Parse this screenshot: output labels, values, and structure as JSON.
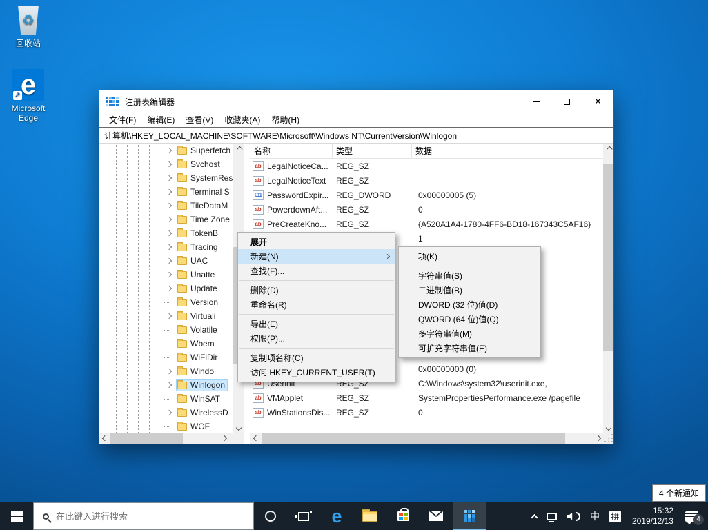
{
  "desktop": {
    "icons": [
      {
        "label": "回收站"
      },
      {
        "label": "Microsoft Edge"
      }
    ],
    "background_top": "#1995ea",
    "background_edge": "#085194"
  },
  "window": {
    "title": "注册表编辑器",
    "menubar": [
      {
        "pre": "文件(",
        "key": "F",
        "post": ")"
      },
      {
        "pre": "编辑(",
        "key": "E",
        "post": ")"
      },
      {
        "pre": "查看(",
        "key": "V",
        "post": ")"
      },
      {
        "pre": "收藏夹(",
        "key": "A",
        "post": ")"
      },
      {
        "pre": "帮助(",
        "key": "H",
        "post": ")"
      }
    ],
    "address": "计算机\\HKEY_LOCAL_MACHINE\\SOFTWARE\\Microsoft\\Windows NT\\CurrentVersion\\Winlogon",
    "tree": {
      "items": [
        {
          "label": "Superfetch",
          "has_children": true,
          "selected": false
        },
        {
          "label": "Svchost",
          "has_children": true,
          "selected": false
        },
        {
          "label": "SystemRes",
          "has_children": true,
          "selected": false
        },
        {
          "label": "Terminal S",
          "has_children": true,
          "selected": false
        },
        {
          "label": "TileDataM",
          "has_children": true,
          "selected": false
        },
        {
          "label": "Time Zone",
          "has_children": true,
          "selected": false
        },
        {
          "label": "TokenB",
          "has_children": true,
          "selected": false
        },
        {
          "label": "Tracing",
          "has_children": true,
          "selected": false
        },
        {
          "label": "UAC",
          "has_children": true,
          "selected": false
        },
        {
          "label": "Unatte",
          "has_children": true,
          "selected": false
        },
        {
          "label": "Update",
          "has_children": true,
          "selected": false
        },
        {
          "label": "Version",
          "has_children": false,
          "selected": false
        },
        {
          "label": "Virtuali",
          "has_children": true,
          "selected": false
        },
        {
          "label": "Volatile",
          "has_children": false,
          "selected": false
        },
        {
          "label": "Wbem",
          "has_children": false,
          "selected": false
        },
        {
          "label": "WiFiDir",
          "has_children": false,
          "selected": false
        },
        {
          "label": "Windo",
          "has_children": true,
          "selected": false
        },
        {
          "label": "Winlogon",
          "has_children": true,
          "selected": true
        },
        {
          "label": "WinSAT",
          "has_children": false,
          "selected": false
        },
        {
          "label": "WirelessD",
          "has_children": true,
          "selected": false
        },
        {
          "label": "WOF",
          "has_children": false,
          "selected": false
        }
      ]
    },
    "values": {
      "headers": [
        "名称",
        "类型",
        "数据"
      ],
      "rows": [
        {
          "icon": "sz",
          "name": "LegalNoticeCa...",
          "type": "REG_SZ",
          "data": ""
        },
        {
          "icon": "sz",
          "name": "LegalNoticeText",
          "type": "REG_SZ",
          "data": ""
        },
        {
          "icon": "dword",
          "name": "PasswordExpir...",
          "type": "REG_DWORD",
          "data": "0x00000005 (5)"
        },
        {
          "icon": "sz",
          "name": "PowerdownAft...",
          "type": "REG_SZ",
          "data": "0"
        },
        {
          "icon": "sz",
          "name": "PreCreateKno...",
          "type": "REG_SZ",
          "data": "{A520A1A4-1780-4FF6-BD18-167343C5AF16}"
        },
        {
          "icon": "",
          "name": "",
          "type": "",
          "data": "1"
        },
        {
          "icon": "",
          "name": "",
          "type": "",
          "data": ""
        },
        {
          "icon": "",
          "name": "",
          "type": "",
          "data": ""
        },
        {
          "icon": "",
          "name": "",
          "type": "",
          "data": ""
        },
        {
          "icon": "",
          "name": "",
          "type": "",
          "data": ""
        },
        {
          "icon": "",
          "name": "",
          "type": "",
          "data": ""
        },
        {
          "icon": "",
          "name": "",
          "type": "",
          "data": ""
        },
        {
          "icon": "",
          "name": "",
          "type": "",
          "data": ""
        },
        {
          "icon": "",
          "name": "",
          "type": "",
          "data": ""
        },
        {
          "icon": "",
          "name": "",
          "type": "",
          "data": "0x00000000 (0)"
        },
        {
          "icon": "sz",
          "name": "Userinit",
          "type": "REG_SZ",
          "data": "C:\\Windows\\system32\\userinit.exe,"
        },
        {
          "icon": "sz",
          "name": "VMApplet",
          "type": "REG_SZ",
          "data": "SystemPropertiesPerformance.exe /pagefile"
        },
        {
          "icon": "sz",
          "name": "WinStationsDis...",
          "type": "REG_SZ",
          "data": "0"
        }
      ]
    }
  },
  "context_menu": {
    "items": [
      "展开",
      "新建(N)",
      "查找(F)...",
      "删除(D)",
      "重命名(R)",
      "导出(E)",
      "权限(P)...",
      "复制项名称(C)",
      "访问 HKEY_CURRENT_USER(T)"
    ],
    "default_index": 0,
    "highlighted_index": 1
  },
  "new_submenu": {
    "items": [
      "项(K)",
      "字符串值(S)",
      "二进制值(B)",
      "DWORD (32 位)值(D)",
      "QWORD (64 位)值(Q)",
      "多字符串值(M)",
      "可扩充字符串值(E)"
    ]
  },
  "taskbar": {
    "search_placeholder": "在此键入进行搜索",
    "ime_mode": "中",
    "ime_scheme": "拼",
    "clock": {
      "time": "15:32",
      "date": "2019/12/13"
    },
    "notification_count": "4",
    "notification_tooltip": "4 个新通知"
  },
  "icons": {
    "reg_sz_glyph": "ab",
    "reg_dword_glyph": "011",
    "close_glyph": "✕",
    "edge_letter": "e",
    "recycle_glyph": "♻",
    "shortcut_arrow_glyph": "↗"
  },
  "colors": {
    "accent": "#0078d7",
    "tree_selection": "#cce8ff",
    "menu_highlight": "#cce4f7",
    "taskbar_bg": "#16212c"
  }
}
